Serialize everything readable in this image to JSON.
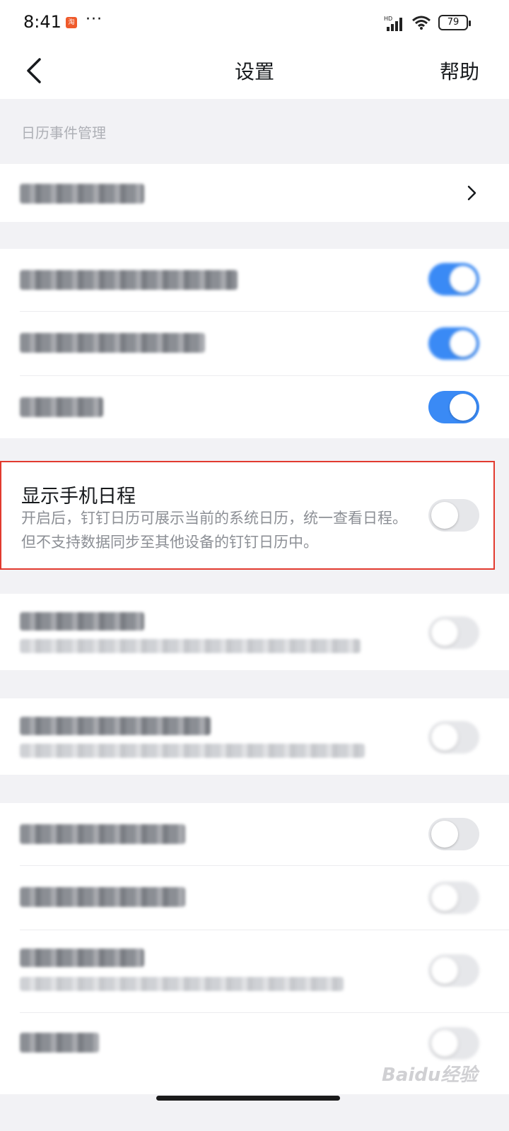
{
  "status_bar": {
    "time": "8:41",
    "app_badge": "淘",
    "more": "···",
    "battery": "79"
  },
  "nav": {
    "title": "设置",
    "help": "帮助"
  },
  "section": {
    "calendar_event_header": "日历事件管理"
  },
  "highlight": {
    "title": "显示手机日程",
    "description": "开启后，钉钉日历可展示当前的系统日历，统一查看日程。但不支持数据同步至其他设备的钉钉日历中。",
    "toggle_state": "off"
  },
  "toggles": {
    "row1": "on",
    "row2": "on",
    "row3": "on",
    "row5": "off",
    "row6": "off",
    "row7": "off",
    "row8": "off",
    "row9": "off",
    "row10": "off"
  },
  "watermark": "Baidu经验"
}
